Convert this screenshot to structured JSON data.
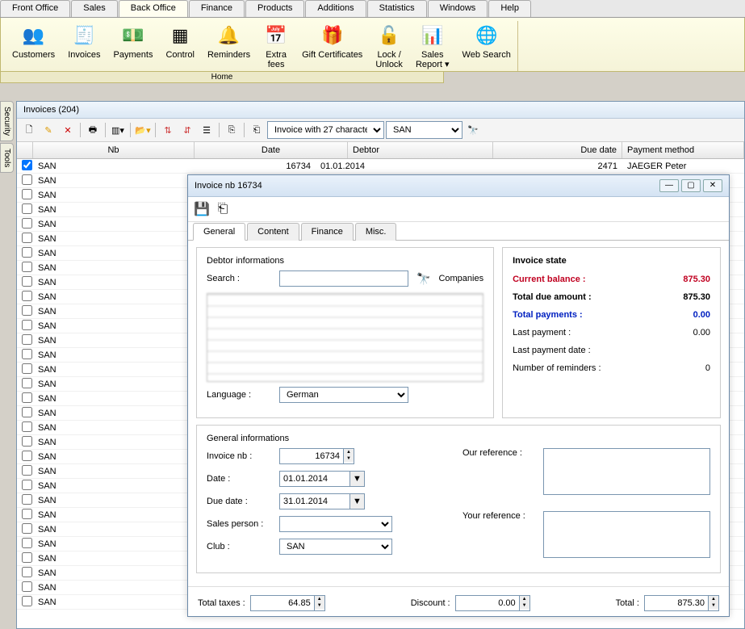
{
  "menu": {
    "tabs": [
      "Front Office",
      "Sales",
      "Back Office",
      "Finance",
      "Products",
      "Additions",
      "Statistics",
      "Windows",
      "Help"
    ],
    "active": 2
  },
  "ribbon": {
    "items": [
      {
        "icon": "👥",
        "label": "Customers"
      },
      {
        "icon": "🧾",
        "label": "Invoices"
      },
      {
        "icon": "💵",
        "label": "Payments"
      },
      {
        "icon": "▦",
        "label": "Control"
      },
      {
        "icon": "🔔",
        "label": "Reminders"
      },
      {
        "icon": "📅",
        "label": "Extra\nfees"
      },
      {
        "icon": "🎁",
        "label": "Gift Certificates"
      },
      {
        "icon": "🔓",
        "label": "Lock /\nUnlock"
      },
      {
        "icon": "📊",
        "label": "Sales\nReport ▾"
      },
      {
        "icon": "🌐",
        "label": "Web Search"
      }
    ],
    "footer": "Home"
  },
  "side": [
    "Security",
    "Tools"
  ],
  "list": {
    "title": "Invoices (204)",
    "combo1": "Invoice with 27 characte",
    "combo2": "SAN",
    "columns": {
      "nb": "Nb",
      "date": "Date",
      "debtor": "Debtor",
      "due": "Due date",
      "pay": "Payment method"
    },
    "row1": {
      "nb": "SAN",
      "num": "16734",
      "date": "01.01.2014",
      "due": "2471",
      "pay": "JAEGER Peter"
    },
    "filler": "SAN"
  },
  "dlg": {
    "title": "Invoice nb 16734",
    "tabs": [
      "General",
      "Content",
      "Finance",
      "Misc."
    ],
    "debtor": {
      "section": "Debtor informations",
      "search_label": "Search :",
      "companies": "Companies",
      "language_label": "Language :",
      "language": "German"
    },
    "state": {
      "title": "Invoice state",
      "current_balance_label": "Current balance :",
      "current_balance": "875.30",
      "total_due_label": "Total due amount :",
      "total_due": "875.30",
      "total_pay_label": "Total payments :",
      "total_pay": "0.00",
      "last_pay_label": "Last payment :",
      "last_pay": "0.00",
      "last_date_label": "Last payment date :",
      "last_date": "",
      "reminders_label": "Number of reminders :",
      "reminders": "0"
    },
    "gen": {
      "section": "General informations",
      "invoice_nb_label": "Invoice nb :",
      "invoice_nb": "16734",
      "date_label": "Date :",
      "date": "01.01.2014",
      "due_label": "Due date :",
      "due": "31.01.2014",
      "sales_label": "Sales person :",
      "sales": "",
      "club_label": "Club :",
      "club": "SAN",
      "ourref_label": "Our reference :",
      "ourref": "",
      "yourref_label": "Your reference :",
      "yourref": ""
    },
    "footer": {
      "taxes_label": "Total taxes :",
      "taxes": "64.85",
      "discount_label": "Discount :",
      "discount": "0.00",
      "total_label": "Total :",
      "total": "875.30"
    }
  }
}
